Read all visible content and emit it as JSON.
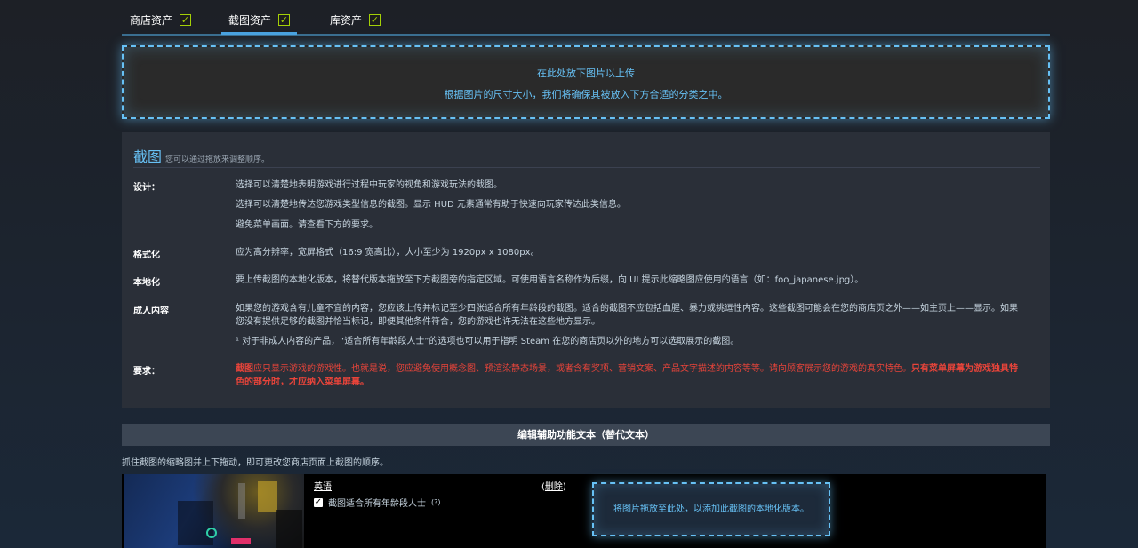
{
  "tabs": [
    {
      "label": "商店资产",
      "checked": true
    },
    {
      "label": "截图资产",
      "checked": true,
      "active": true
    },
    {
      "label": "库资产",
      "checked": true
    }
  ],
  "upload": {
    "line1": "在此处放下图片以上传",
    "line2": "根据图片的尺寸大小，我们将确保其被放入下方合适的分类之中。"
  },
  "screenshots": {
    "title": "截图",
    "subtitle": "您可以通过拖放来调整顺序。",
    "rows": {
      "design": {
        "label": "设计：",
        "lines": [
          "选择可以清楚地表明游戏进行过程中玩家的视角和游戏玩法的截图。",
          "选择可以清楚地传达您游戏类型信息的截图。显示 HUD 元素通常有助于快速向玩家传达此类信息。",
          "避免菜单画面。请查看下方的要求。"
        ]
      },
      "format": {
        "label": "格式化",
        "text": "应为高分辨率，宽屏格式（16:9 宽高比），大小至少为 1920px x 1080px。"
      },
      "localization": {
        "label": "本地化",
        "text": "要上传截图的本地化版本，将替代版本拖放至下方截图旁的指定区域。可使用语言名称作为后缀，向 UI 提示此缩略图应使用的语言（如：foo_japanese.jpg）。"
      },
      "adult": {
        "label": "成人内容",
        "text": "如果您的游戏含有儿童不宜的内容，您应该上传并标记至少四张适合所有年龄段的截图。适合的截图不应包括血腥、暴力或挑逗性内容。这些截图可能会在您的商店页之外——如主页上——显示。如果您没有提供足够的截图并恰当标记，即便其他条件符合，您的游戏也许无法在这些地方显示。",
        "note": "¹ 对于非成人内容的产品，“适合所有年龄段人士”的选项也可以用于指明 Steam 在您的商店页以外的地方可以选取展示的截图。"
      },
      "requirements": {
        "label": "要求：",
        "bold": "截图",
        "text": "应只显示游戏的游戏性。也就是说，您应避免使用概念图、预渲染静态场景，或者含有奖项、营销文案、产品文字描述的内容等等。请向顾客展示您的游戏的真实特色。",
        "bold2": "只有菜单屏幕为游戏独具特色的部分时，才应纳入菜单屏幕。"
      }
    }
  },
  "alt_text_bar": "编辑辅助功能文本（替代文本）",
  "drag_hint": "抓住截图的缩略图并上下拖动，即可更改您商店页面上截图的顺序。",
  "item": {
    "language": "英语",
    "delete_label": "删除",
    "all_ages_label": "截图适合所有年龄段人士",
    "all_ages_checked": true,
    "help": "(?)",
    "localize_drop": "将图片拖放至此处，以添加此截图的本地化版本。"
  }
}
